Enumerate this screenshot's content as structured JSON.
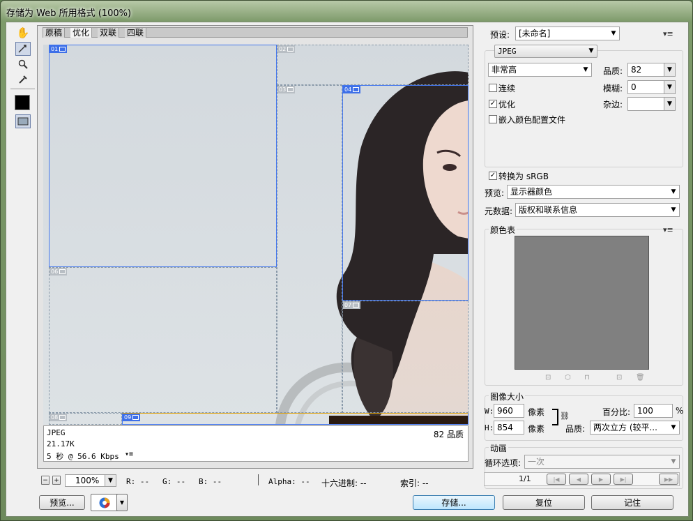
{
  "window": {
    "title": "存储为 Web 所用格式 (100%)"
  },
  "tools": {
    "hand": "hand-tool",
    "slice_select": "slice-select-tool",
    "zoom": "zoom-tool",
    "eyedropper": "eyedropper-tool"
  },
  "tabs": [
    "原稿",
    "优化",
    "双联",
    "四联"
  ],
  "slices": [
    "01",
    "02",
    "03",
    "04",
    "05",
    "06",
    "07",
    "08",
    "09"
  ],
  "info": {
    "format": "JPEG",
    "size": "21.17K",
    "speed": "5 秒 @ 56.6 Kbps",
    "quality": "82 品质"
  },
  "status": {
    "zoom": "100%",
    "r": "R: --",
    "g": "G: --",
    "b": "B: --",
    "alpha": "Alpha: --",
    "hex": "十六进制: --",
    "index": "索引: --"
  },
  "buttons": {
    "preview": "预览...",
    "save": "存储...",
    "reset": "复位",
    "remember": "记住"
  },
  "settings": {
    "preset_label": "预设:",
    "preset_value": "[未命名]",
    "format": "JPEG",
    "quality_level": "非常高",
    "quality_label": "品质:",
    "quality_value": "82",
    "progressive_label": "连续",
    "blur_label": "模糊:",
    "blur_value": "0",
    "optimized_label": "优化",
    "matte_label": "杂边:",
    "embed_label": "嵌入颜色配置文件",
    "convert_label": "转换为 sRGB",
    "preview_label": "预览:",
    "preview_value": "显示器颜色",
    "metadata_label": "元数据:",
    "metadata_value": "版权和联系信息"
  },
  "color_table": {
    "title": "颜色表",
    "swatch_color": "#808080"
  },
  "image_size": {
    "title": "图像大小",
    "w_label": "W:",
    "w_value": "960",
    "h_label": "H:",
    "h_value": "854",
    "unit": "像素",
    "percent_label": "百分比:",
    "percent_value": "100",
    "percent_unit": "%",
    "quality_label": "品质:",
    "quality_value": "两次立方 (较平..."
  },
  "animation": {
    "title": "动画",
    "loop_label": "循环选项:",
    "loop_value": "一次",
    "frame": "1/1"
  }
}
